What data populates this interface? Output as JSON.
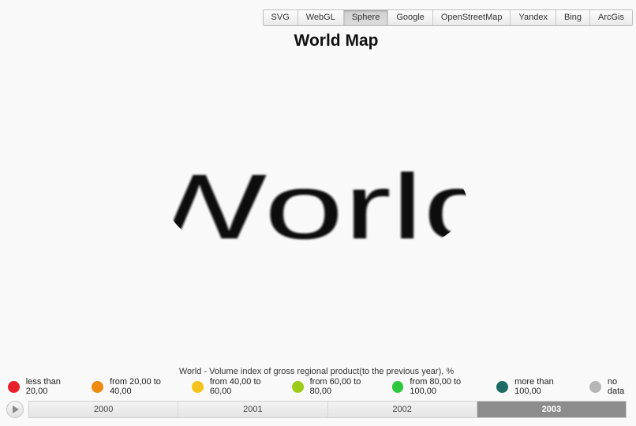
{
  "toolbar": {
    "buttons": [
      {
        "label": "SVG",
        "active": false
      },
      {
        "label": "WebGL",
        "active": false
      },
      {
        "label": "Sphere",
        "active": true
      },
      {
        "label": "Google",
        "active": false
      },
      {
        "label": "OpenStreetMap",
        "active": false
      },
      {
        "label": "Yandex",
        "active": false
      },
      {
        "label": "Bing",
        "active": false
      },
      {
        "label": "ArcGis",
        "active": false
      }
    ]
  },
  "title": "World Map",
  "sphere": {
    "texture_text": "World"
  },
  "legend": {
    "caption": "World - Volume index of gross regional product(to the previous year), %",
    "items": [
      {
        "label": "less than 20,00",
        "color": "#e8202a"
      },
      {
        "label": "from 20,00 to 40,00",
        "color": "#ef8a13"
      },
      {
        "label": "from 40,00 to 60,00",
        "color": "#f3c31b"
      },
      {
        "label": "from 60,00 to 80,00",
        "color": "#9dcb18"
      },
      {
        "label": "from 80,00 to 100,00",
        "color": "#2ec83c"
      },
      {
        "label": "more than 100,00",
        "color": "#1f6b64"
      },
      {
        "label": "no data",
        "color": "#b5b5b5"
      }
    ]
  },
  "timeline": {
    "play_icon": "play-icon",
    "years": [
      {
        "label": "2000",
        "active": false
      },
      {
        "label": "2001",
        "active": false
      },
      {
        "label": "2002",
        "active": false
      },
      {
        "label": "2003",
        "active": true
      }
    ]
  }
}
